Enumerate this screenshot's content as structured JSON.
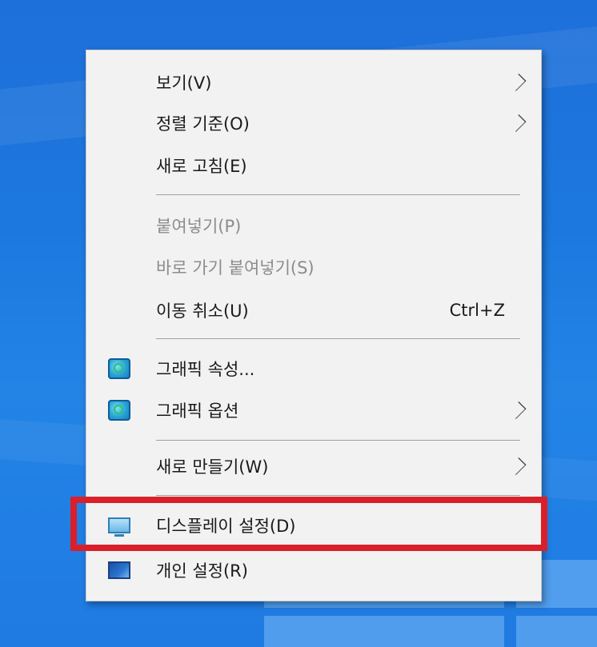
{
  "context_menu": {
    "items": [
      {
        "label": "보기(V)",
        "submenu": true
      },
      {
        "label": "정렬 기준(O)",
        "submenu": true
      },
      {
        "label": "새로 고침(E)"
      },
      {
        "label": "붙여넣기(P)",
        "disabled": true
      },
      {
        "label": "바로 가기 붙여넣기(S)",
        "disabled": true
      },
      {
        "label": "이동 취소(U)",
        "shortcut": "Ctrl+Z"
      },
      {
        "label": "그래픽 속성...",
        "icon": "intel-graphics-icon"
      },
      {
        "label": "그래픽 옵션",
        "icon": "intel-graphics-icon",
        "submenu": true
      },
      {
        "label": "새로 만들기(W)",
        "submenu": true
      },
      {
        "label": "디스플레이 설정(D)",
        "icon": "display-icon",
        "highlighted": true
      },
      {
        "label": "개인 설정(R)",
        "icon": "personalize-icon"
      }
    ]
  },
  "colors": {
    "highlight_border": "#d9202a",
    "menu_background": "#f2f2f2",
    "desktop_background": "#1e74dc"
  }
}
